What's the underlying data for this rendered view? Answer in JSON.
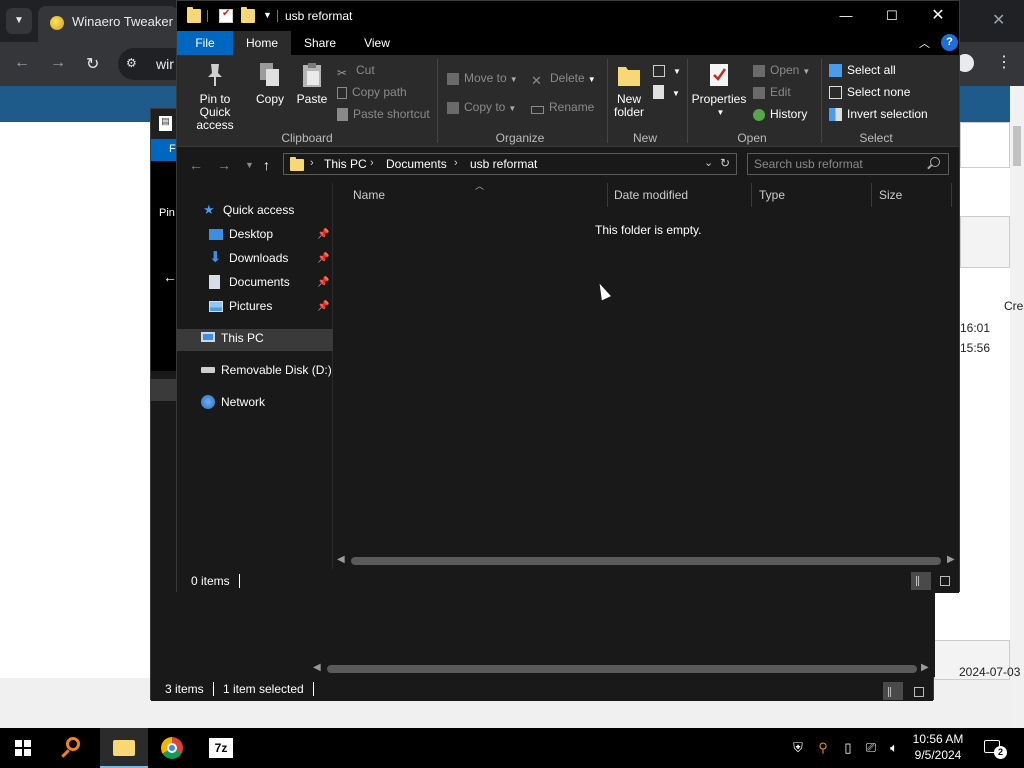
{
  "browser": {
    "tab_title": "Winaero Tweaker",
    "url_partial": "wir",
    "page_fragments": {
      "created_header": "Crea",
      "time_1": "16:01",
      "time_2": "15:56",
      "date_cell": "2024-07-03"
    }
  },
  "back_window": {
    "file_tab_partial": "F",
    "ribbon_partial_1": "Pin",
    "status": {
      "items_count": "3 items",
      "selected": "1 item selected"
    }
  },
  "window": {
    "title": "usb reformat",
    "controls": {
      "minimize": "—",
      "maximize": "☐",
      "close": "✕"
    }
  },
  "ribbon": {
    "tabs": [
      {
        "label": "File"
      },
      {
        "label": "Home"
      },
      {
        "label": "Share"
      },
      {
        "label": "View"
      }
    ],
    "clipboard": {
      "pin_label": "Pin to Quick access",
      "copy_label": "Copy",
      "paste_label": "Paste",
      "cut_label": "Cut",
      "copy_path_label": "Copy path",
      "paste_shortcut_label": "Paste shortcut",
      "group_label": "Clipboard"
    },
    "organize": {
      "move_to_label": "Move to",
      "copy_to_label": "Copy to",
      "delete_label": "Delete",
      "rename_label": "Rename",
      "group_label": "Organize"
    },
    "new": {
      "new_folder_label": "New folder",
      "group_label": "New"
    },
    "open": {
      "properties_label": "Properties",
      "open_label": "Open",
      "edit_label": "Edit",
      "history_label": "History",
      "group_label": "Open"
    },
    "select": {
      "select_all_label": "Select all",
      "select_none_label": "Select none",
      "invert_label": "Invert selection",
      "group_label": "Select"
    }
  },
  "address": {
    "breadcrumbs": [
      "This PC",
      "Documents",
      "usb reformat"
    ],
    "search_placeholder": "Search usb reformat"
  },
  "nav_pane": {
    "quick_access": "Quick access",
    "items": [
      {
        "label": "Desktop",
        "icon": "desktop-icon"
      },
      {
        "label": "Downloads",
        "icon": "downloads-icon"
      },
      {
        "label": "Documents",
        "icon": "documents-icon"
      },
      {
        "label": "Pictures",
        "icon": "pictures-icon"
      }
    ],
    "this_pc": "This PC",
    "removable": "Removable Disk (D:)",
    "network": "Network"
  },
  "content": {
    "columns": [
      "Name",
      "Date modified",
      "Type",
      "Size"
    ],
    "empty_message": "This folder is empty."
  },
  "status_bar": {
    "items_count": "0 items"
  },
  "taskbar": {
    "apps": [
      "start-icon",
      "search-icon",
      "file-explorer-icon",
      "chrome-icon",
      "7zip-icon"
    ],
    "seven_zip_label": "7z",
    "time": "10:56 AM",
    "date": "9/5/2024",
    "notification_count": "2"
  },
  "colors": {
    "accent_blue": "#0067c0",
    "folder_yellow": "#f8d775",
    "dark_bg": "#191919",
    "ribbon_bg": "#2b2b2b"
  }
}
